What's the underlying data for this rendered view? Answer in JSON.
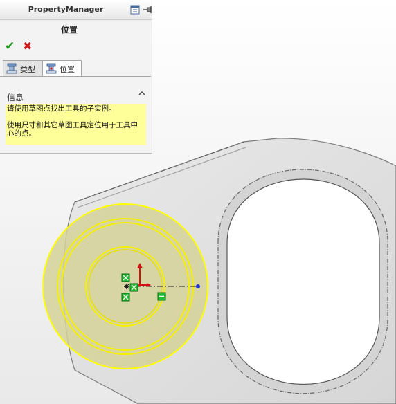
{
  "property_manager": {
    "title": "PropertyManager",
    "feature_title": "位置",
    "icons": [
      "pin-icon",
      "ok-check-icon",
      "cancel-x-icon",
      "collapse-chevron-icon"
    ],
    "tabs": [
      {
        "label": "类型",
        "icon": "hole-type-icon",
        "active": false
      },
      {
        "label": "位置",
        "icon": "hole-position-icon",
        "active": true
      }
    ],
    "info": {
      "header": "信息",
      "line1": "请使用草图点找出工具的子实例。",
      "line2": "使用尺寸和其它草图工具定位用于工具中心的点。"
    }
  },
  "colors": {
    "ok": "#1a9a1a",
    "cancel": "#d11a1a",
    "info_background": "#ffff99",
    "highlight": "#ffff00",
    "part_face": "#e2e2e2",
    "sketch_point": "#22bb33"
  }
}
